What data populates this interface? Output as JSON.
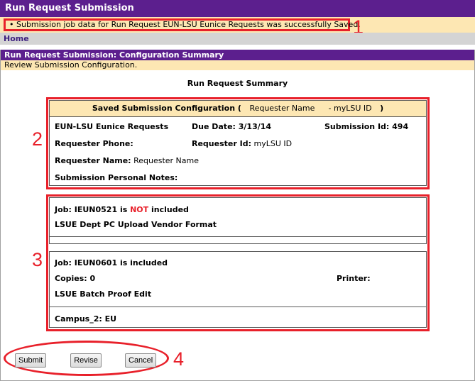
{
  "header": {
    "title": "Run Request Submission"
  },
  "message": {
    "text": "• Submission job data for Run Request EUN-LSU Eunice Requests was successfully Saved."
  },
  "nav": {
    "home": "Home"
  },
  "panel": {
    "title": "Run Request Submission: Configuration Summary",
    "subtitle": "Review Submission Configuration.",
    "summary_title": "Run Request Summary"
  },
  "config": {
    "heading_prefix": "Saved Submission Configuration (",
    "requester_name_value": "Requester Name",
    "dash_id": "-  myLSU ID",
    "heading_suffix": ")",
    "request_name": "EUN-LSU Eunice Requests",
    "due_date": "Due Date: 3/13/14",
    "submission_id": "Submission Id: 494",
    "requester_phone_label": "Requester Phone:",
    "requester_id_label": "Requester Id:",
    "requester_id_value": "myLSU ID",
    "requester_name_label": "Requester Name:",
    "requester_name_text": "Requester Name",
    "notes_label": "Submission Personal Notes:"
  },
  "jobs": [
    {
      "prefix": "Job: IEUN0521 is ",
      "flag": "NOT",
      "suffix": " included",
      "description": "LSUE Dept PC Upload Vendor Format"
    },
    {
      "title": "Job: IEUN0601 is included",
      "copies": "Copies: 0",
      "printer": "Printer:",
      "description": "LSUE Batch Proof Edit",
      "campus": "Campus_2: EU"
    }
  ],
  "buttons": {
    "submit": "Submit",
    "revise": "Revise",
    "cancel": "Cancel"
  },
  "annotations": [
    "1",
    "2",
    "3",
    "4"
  ],
  "colors": {
    "header_purple": "#5c1f8e",
    "banner_tan": "#fde7b3",
    "annotation_red": "#e8202a"
  }
}
